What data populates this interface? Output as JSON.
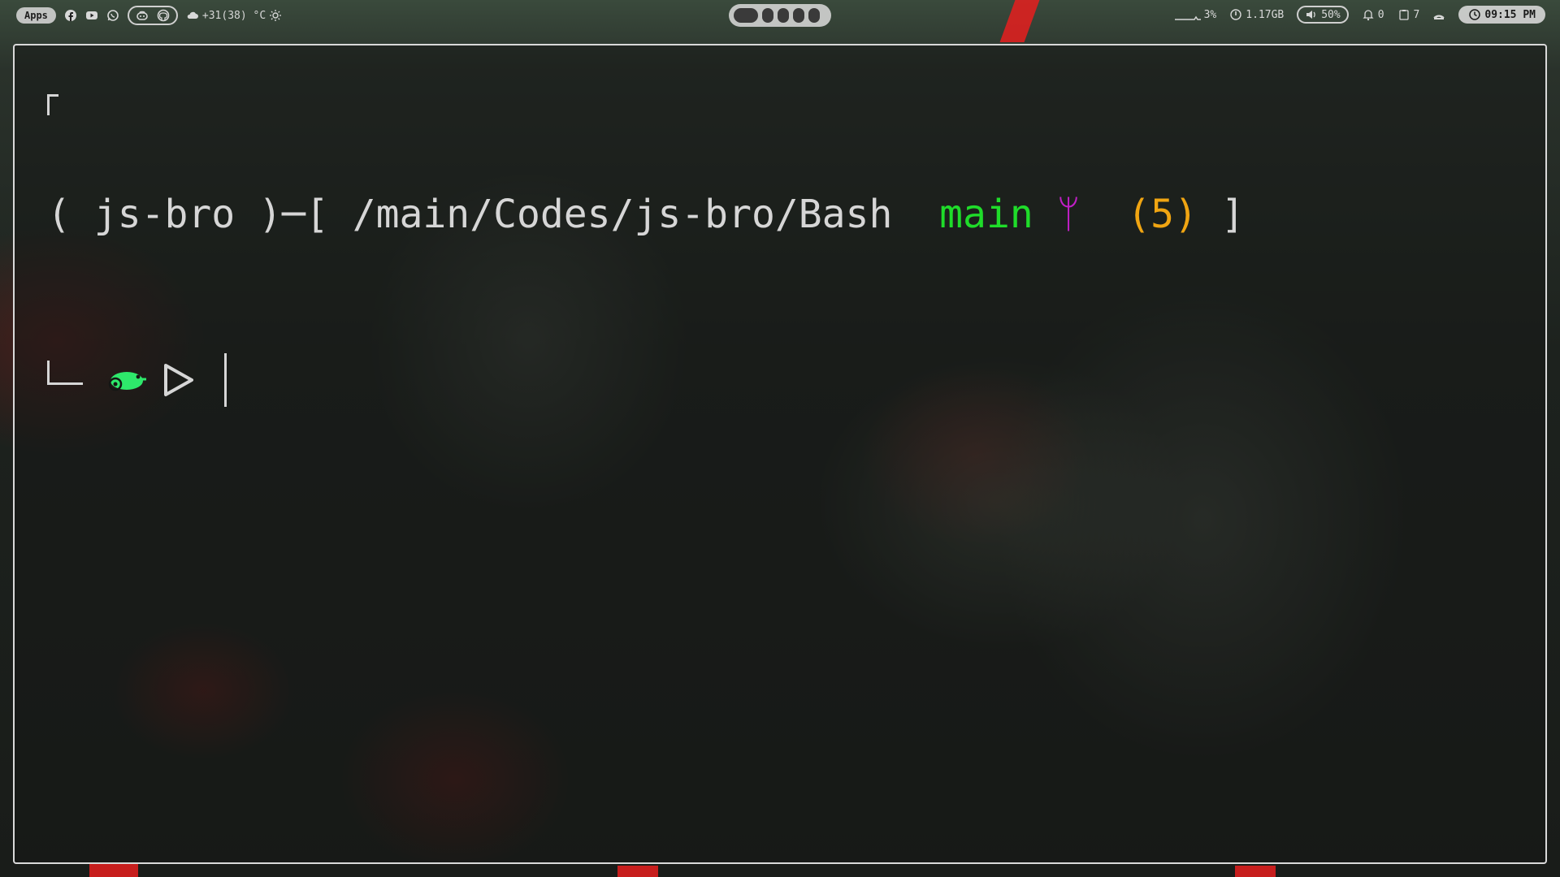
{
  "topbar": {
    "apps_label": "Apps",
    "weather_text": "+31(38) °C",
    "cpu_text": "3%",
    "memory_text": "1.17GB",
    "volume_text": "50%",
    "notifications_text": "0",
    "clipboard_text": "7",
    "clock_text": "09:15 PM",
    "workspaces": [
      {
        "active": true
      },
      {
        "active": false
      },
      {
        "active": false
      },
      {
        "active": false
      },
      {
        "active": false
      }
    ]
  },
  "terminal": {
    "open_paren": "( ",
    "user": "js-bro",
    "close_paren_dash": " )─[ ",
    "path": "/main/Codes/js-bro/Bash",
    "branch": "main",
    "git_symbol": "ᛘ",
    "count": "(5)",
    "close_bracket": " ]"
  },
  "colors": {
    "branch": "#1fdc2a",
    "git_icon": "#c11fc6",
    "count": "#f0a512",
    "prompt_icon": "#2ee86b"
  }
}
